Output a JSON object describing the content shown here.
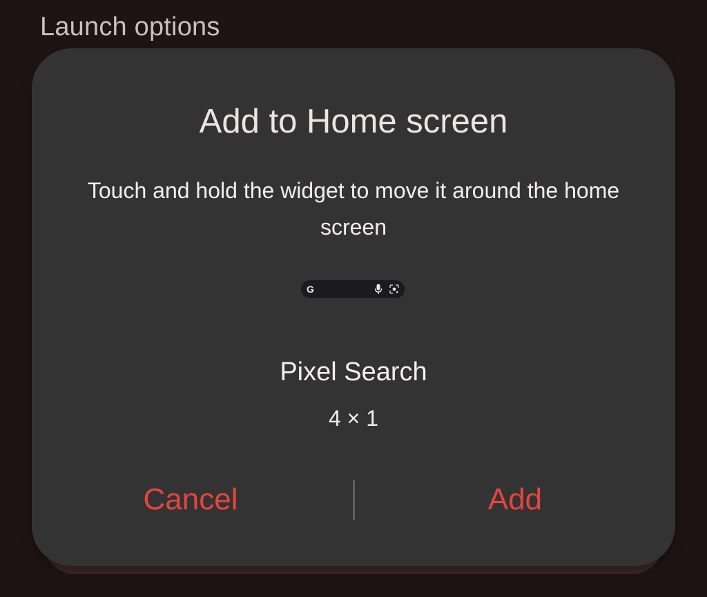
{
  "header": {
    "title": "Launch options"
  },
  "dialog": {
    "title": "Add to Home screen",
    "description": "Touch and hold the widget to move it around the home screen",
    "widget": {
      "preview_logo": "G",
      "icons": [
        "google-g-icon",
        "mic-icon",
        "lens-icon"
      ],
      "name": "Pixel Search",
      "size": "4 × 1"
    },
    "buttons": {
      "cancel_label": "Cancel",
      "add_label": "Add"
    }
  },
  "colors": {
    "background": "#1e1413",
    "dialog": "#333333",
    "accent": "#e5453f",
    "text": "#f3efee",
    "muted_text": "#cdbfbd"
  }
}
